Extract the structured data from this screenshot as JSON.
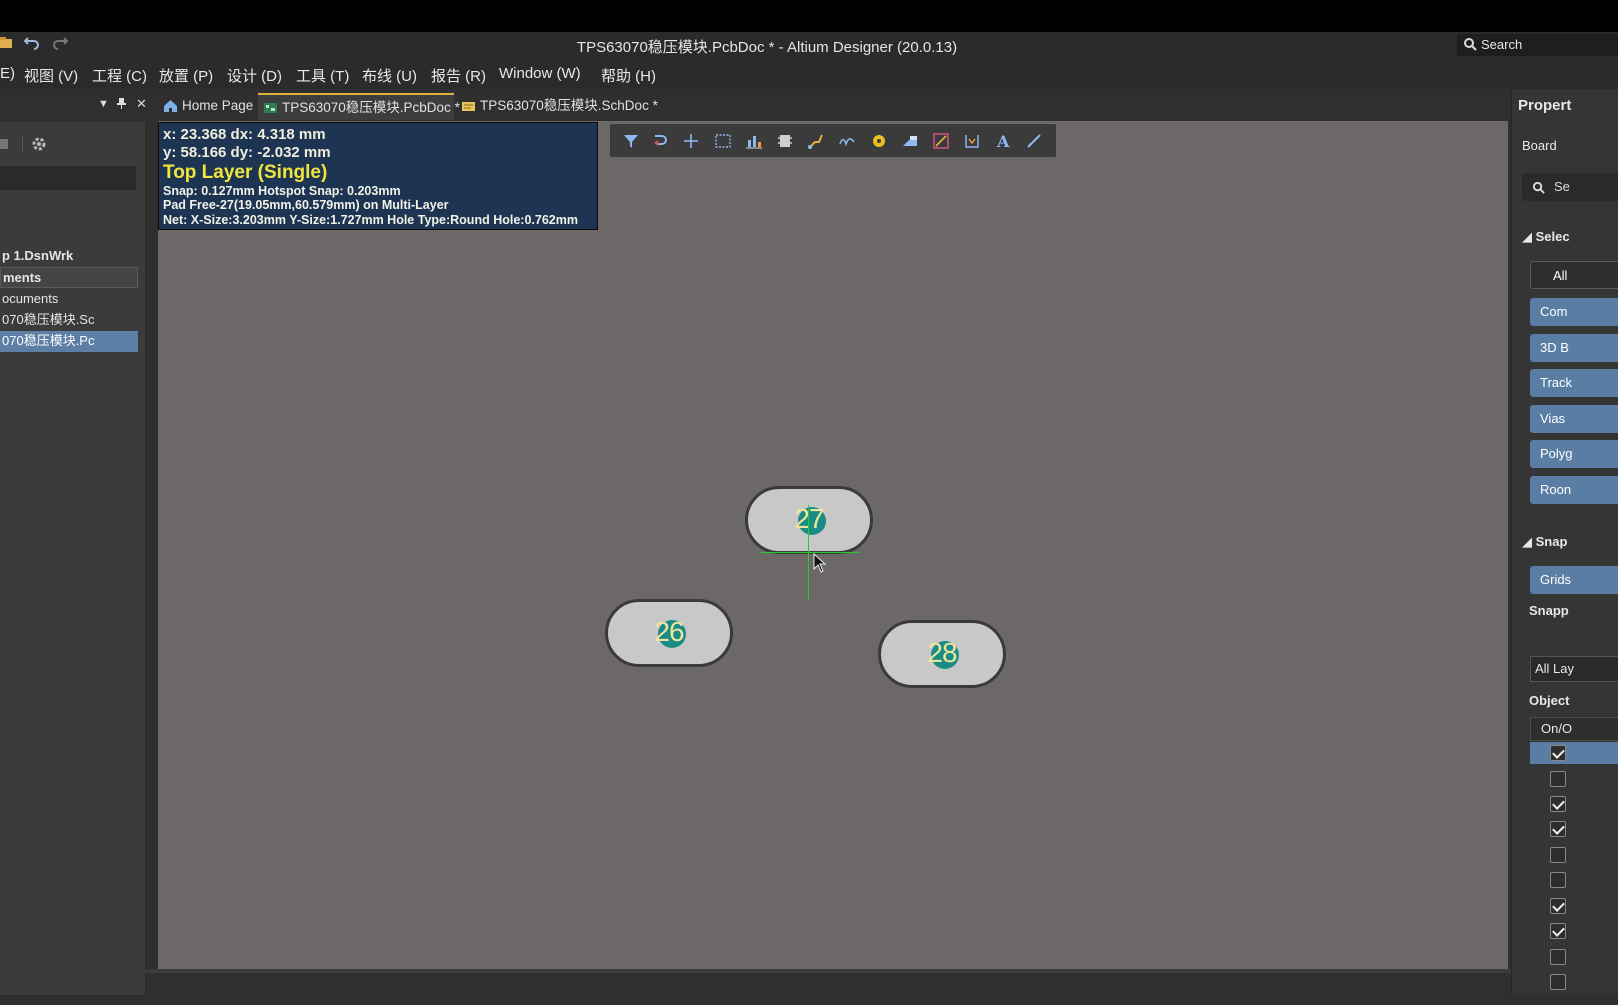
{
  "window": {
    "title": "TPS63070稳压模块.PcbDoc * - Altium Designer (20.0.13)"
  },
  "titlebar": {
    "search_label": "Search"
  },
  "menu": [
    {
      "label": "E)"
    },
    {
      "label": "视图 (V)"
    },
    {
      "label": "工程 (C)"
    },
    {
      "label": "放置 (P)"
    },
    {
      "label": "设计 (D)"
    },
    {
      "label": "工具 (T)"
    },
    {
      "label": "布线 (U)"
    },
    {
      "label": "报告 (R)"
    },
    {
      "label": "Window (W)"
    },
    {
      "label": "帮助 (H)"
    }
  ],
  "left_panel": {
    "tree": [
      {
        "label": "p 1.DsnWrk"
      },
      {
        "label": "ments"
      },
      {
        "label": "ocuments"
      },
      {
        "label": "070稳压模块.Sc"
      },
      {
        "label": "070稳压模块.Pc"
      }
    ]
  },
  "tabs": [
    {
      "label": "Home Page"
    },
    {
      "label": "TPS63070稳压模块.PcbDoc *"
    },
    {
      "label": "TPS63070稳压模块.SchDoc *"
    }
  ],
  "hud": {
    "line1": "x: 23.368   dx:  4.318 mm",
    "line2": "y: 58.166   dy: -2.032 mm",
    "layer": "Top Layer (Single)",
    "snap": "Snap: 0.127mm Hotspot Snap: 0.203mm",
    "pad": "Pad Free-27(19.05mm,60.579mm) on Multi-Layer",
    "net": "Net: X-Size:3.203mm Y-Size:1.727mm Hole Type:Round Hole:0.762mm"
  },
  "toolbar_icons": [
    "filter-icon",
    "select-connected-icon",
    "cross-icon",
    "select-rect-icon",
    "chart-icon",
    "component-icon",
    "route-icon",
    "diff-pair-icon",
    "pad-icon",
    "fill-icon",
    "polygon-icon",
    "dimension-icon",
    "text-icon",
    "line-icon"
  ],
  "pads": [
    {
      "label": "27"
    },
    {
      "label": "26"
    },
    {
      "label": "28"
    }
  ],
  "right_panel": {
    "title": "Propert",
    "board_label": "Board",
    "search_placeholder": "Se",
    "section_selection": "Selec",
    "all_label": "All",
    "filters": [
      {
        "label": "Com"
      },
      {
        "label": "3D B"
      },
      {
        "label": "Track"
      },
      {
        "label": "Vias"
      },
      {
        "label": "Polyg"
      },
      {
        "label": "Roon"
      }
    ],
    "section_snap": "Snap",
    "grids_label": "Grids",
    "snapping_label": "Snapp",
    "snapping_value": "All Lay",
    "objects_label": "Object",
    "onoff_label": "On/O",
    "checks": [
      true,
      false,
      true,
      true,
      false,
      false,
      true,
      true,
      false,
      false
    ]
  }
}
